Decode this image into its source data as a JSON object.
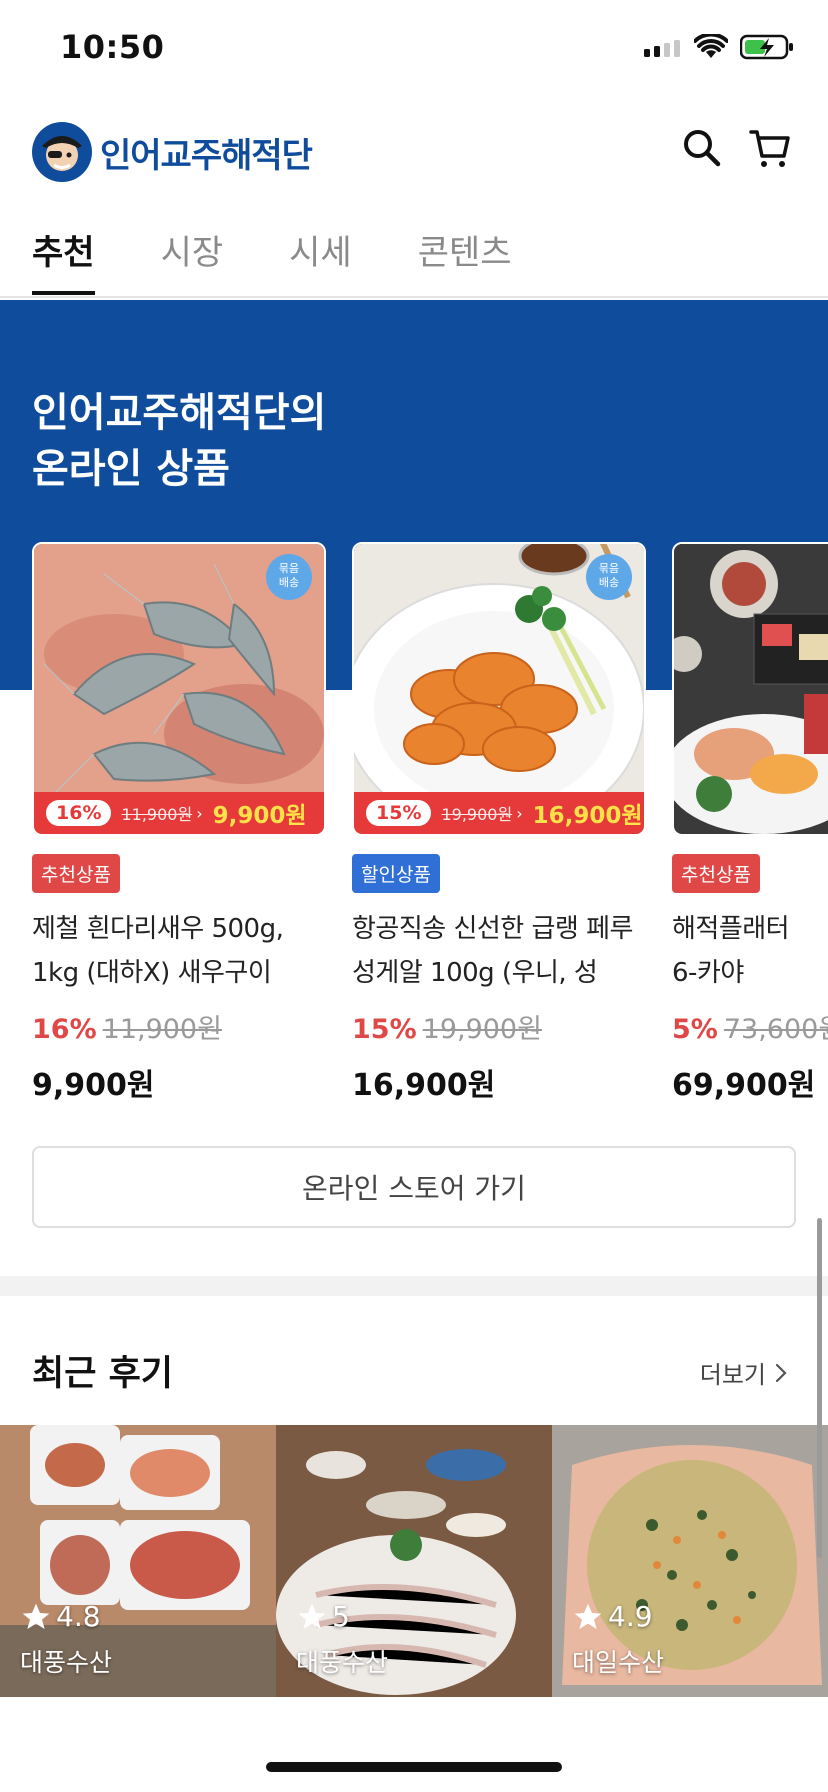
{
  "status_bar": {
    "time": "10:50"
  },
  "header": {
    "logo_text": "인어교주해적단",
    "icons": [
      "search-icon",
      "cart-icon"
    ]
  },
  "tabs": [
    {
      "label": "추천",
      "active": true
    },
    {
      "label": "시장",
      "active": false
    },
    {
      "label": "시세",
      "active": false
    },
    {
      "label": "콘텐츠",
      "active": false
    }
  ],
  "banner": {
    "title_line1": "인어교주해적단의",
    "title_line2": "온라인 상품"
  },
  "products": [
    {
      "bundle_badge": "묶음\n배송",
      "strip_pct": "16%",
      "strip_orig": "11,900원",
      "strip_sale": "9,900원",
      "tag": "추천상품",
      "name": "제철 흰다리새우 500g, 1kg (대하X) 새우구이",
      "discount": "16%",
      "orig_price": "11,900원",
      "price": "9,900원"
    },
    {
      "bundle_badge": "묶음\n배송",
      "strip_pct": "15%",
      "strip_orig": "19,900원",
      "strip_sale": "16,900원",
      "tag": "할인상품",
      "name": "항공직송 신선한 급랭 페루 성게알 100g (우니, 성",
      "discount": "15%",
      "orig_price": "19,900원",
      "price": "16,900원"
    },
    {
      "tag": "추천상품",
      "name": "해적플래터 6-카야",
      "discount": "5%",
      "orig_price": "73,600원",
      "price": "69,900원"
    }
  ],
  "store_button": "온라인 스토어 가기",
  "reviews": {
    "title": "최근 후기",
    "more": "더보기",
    "items": [
      {
        "rating": "4.8",
        "store": "대풍수산"
      },
      {
        "rating": "5",
        "store": "대풍수산"
      },
      {
        "rating": "4.9",
        "store": "대일수산"
      }
    ]
  },
  "colors": {
    "brand_blue": "#0f4c9c",
    "sale_red": "#e63a3a",
    "sale_yellow": "#ffe24a",
    "tag_blue": "#2f6fd6"
  }
}
